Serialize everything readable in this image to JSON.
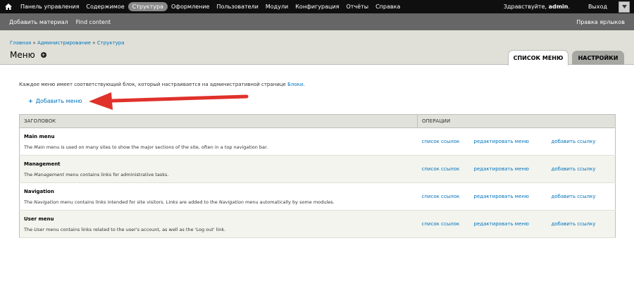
{
  "toolbar": {
    "home_icon": "home-icon",
    "items": [
      "Панель управления",
      "Содержимое",
      "Структура",
      "Оформление",
      "Пользователи",
      "Модули",
      "Конфигурация",
      "Отчёты",
      "Справка"
    ],
    "hello_prefix": "Здравствуйте,",
    "hello_user": "admin",
    "hello_suffix": ".",
    "logout": "Выход"
  },
  "shortcuts": {
    "items": [
      "Добавить материал",
      "Find content"
    ],
    "edit": "Правка ярлыков"
  },
  "breadcrumb": [
    "Главная",
    "Администрирование",
    "Структура"
  ],
  "page_title": "Меню",
  "tabs": {
    "list": "СПИСОК МЕНЮ",
    "settings": "НАСТРОЙКИ"
  },
  "intro": {
    "text": "Каждое меню имеет соответствующий блок, который настраивается на административной странице",
    "link": "Блоки",
    "end": "."
  },
  "add_menu": {
    "icon": "+",
    "label": "Добавить меню"
  },
  "table": {
    "headers": {
      "title": "ЗАГОЛОВОК",
      "ops": "ОПЕРАЦИИ"
    },
    "rows": [
      {
        "name": "Main menu",
        "desc_pre": "The",
        "desc_em": "Main",
        "desc_post": "menu is used on many sites to show the major sections of the site, often in a top navigation bar.",
        "op1": "список ссылок",
        "op2": "редактировать меню",
        "op3": "добавить ссылку"
      },
      {
        "name": "Management",
        "desc_pre": "The",
        "desc_em": "Management",
        "desc_post": "menu contains links for administrative tasks.",
        "op1": "список ссылок",
        "op2": "редактировать меню",
        "op3": "добавить ссылку"
      },
      {
        "name": "Navigation",
        "desc_pre": "The",
        "desc_em": "Navigation",
        "desc_mid": "menu contains links intended for site visitors. Links are added to the",
        "desc_em2": "Navigation",
        "desc_post": "menu automatically by some modules.",
        "op1": "список ссылок",
        "op2": "редактировать меню",
        "op3": "добавить ссылку"
      },
      {
        "name": "User menu",
        "desc_pre": "The",
        "desc_em": "User",
        "desc_post": "menu contains links related to the user's account, as well as the 'Log out' link.",
        "op1": "список ссылок",
        "op2": "редактировать меню",
        "op3": "добавить ссылку"
      }
    ]
  }
}
